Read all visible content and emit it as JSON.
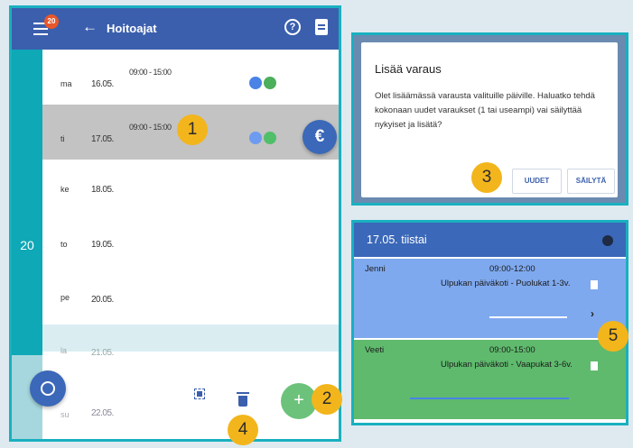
{
  "phone": {
    "notification_count": "20",
    "back_icon": "←",
    "title": "Hoitoajat",
    "help_icon": "?",
    "week_number": "20",
    "rows": [
      {
        "weekday": "ma",
        "date": "16.05.",
        "time": "09:00 - 15:00"
      },
      {
        "weekday": "ti",
        "date": "17.05.",
        "time": "09:00 - 15:00"
      },
      {
        "weekday": "ke",
        "date": "18.05.",
        "time": ""
      },
      {
        "weekday": "to",
        "date": "19.05.",
        "time": ""
      },
      {
        "weekday": "pe",
        "date": "20.05.",
        "time": ""
      },
      {
        "weekday": "la",
        "date": "21.05.",
        "time": ""
      },
      {
        "weekday": "su",
        "date": "22.05.",
        "time": ""
      }
    ],
    "euro_label": "€",
    "add_label": "+"
  },
  "callouts": [
    "1",
    "2",
    "3",
    "4",
    "5"
  ],
  "dialog": {
    "title": "Lisää varaus",
    "text": "Olet lisäämässä varausta valituille päiville. Haluatko tehdä kokonaan uudet varaukset (1 tai useampi) vai säilyttää nykyiset ja lisätä?",
    "button_new": "UUDET",
    "button_keep": "SÄILYTÄ"
  },
  "detail": {
    "title": "17.05. tiistai",
    "entries": [
      {
        "name": "Jenni",
        "time": "09:00-12:00",
        "place": "Ulpukan päiväkoti - Puolukat 1-3v.",
        "chevron": "›"
      },
      {
        "name": "Veeti",
        "time": "09:00-15:00",
        "place": "Ulpukan päiväkoti - Vaapukat 3-6v."
      }
    ]
  },
  "colors": {
    "appbar": "#3b5fad",
    "week_bar": "#0ea8b7",
    "callout": "#f3b51c",
    "child_blue": "#7fa9ee",
    "child_green": "#5fba6d"
  }
}
